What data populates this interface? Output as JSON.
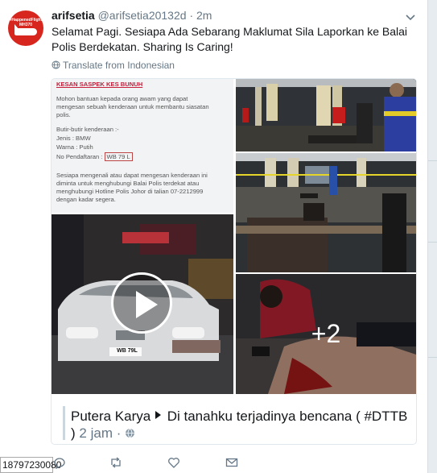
{
  "user": {
    "display_name": "arifsetia",
    "handle": "@arifsetia20132d",
    "separator": "·",
    "time": "2m",
    "avatar_text": "#HappenedFlight MH370"
  },
  "tweet": {
    "text": "Selamat Pagi. Sesiapa Ada Sebarang Maklumat Sila Laporkan ke Balai Polis Berdekatan. Sharing Is Caring!",
    "translate_label": "Translate from Indonesian"
  },
  "notice": {
    "heading": "KESAN SASPEK KES BUNUH",
    "lines": [
      "Mohon bantuan kepada orang awam yang dapat",
      "mengesan sebuah kenderaan untuk membantu siasatan",
      "polis.",
      "Butir-butir kenderaan :-",
      "Jenis : BMW",
      "Warna : Putih",
      "No Pendaftaran :",
      "Sesiapa mengenali atau dapat mengesan kenderaan ini",
      "diminta untuk menghubungi Balai Polis terdekat atau",
      "menghubungi Hotline Polis Johor di talian  07-2212999",
      "dengan kadar segera."
    ],
    "plate": "WB 79 L"
  },
  "media": {
    "video_plate": "WB 79L",
    "more_count": "+2"
  },
  "link": {
    "author": "Putera Karya",
    "title": "Di tanahku terjadinya bencana ( #DTTB )",
    "age": "2 jam"
  },
  "footer": {
    "tweet_id_fragment": "18797230080"
  },
  "colors": {
    "name": "#14171a",
    "muted": "#657786",
    "link_bar": "#ccd6dd",
    "avatar_bg": "#d7261e"
  }
}
